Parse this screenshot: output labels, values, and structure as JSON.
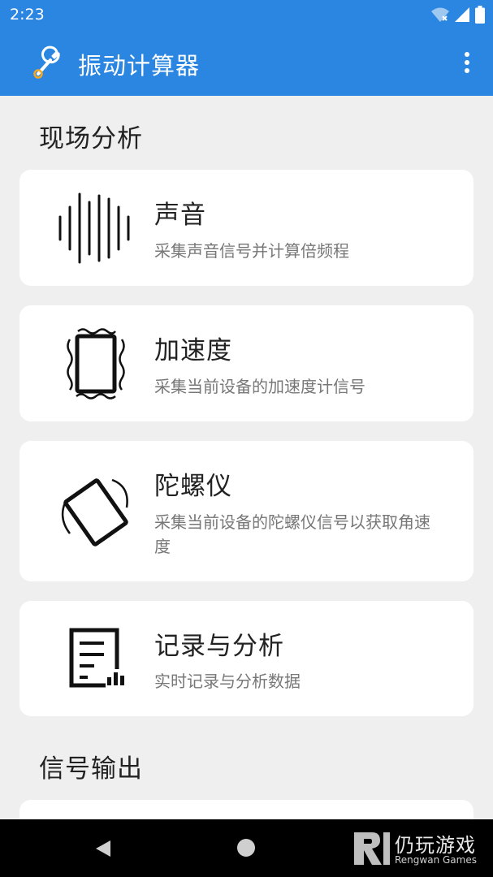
{
  "status_bar": {
    "time": "2:23"
  },
  "app_bar": {
    "title": "振动计算器"
  },
  "sections": [
    {
      "title": "现场分析",
      "cards": [
        {
          "title": "声音",
          "description": "采集声音信号并计算倍频程",
          "icon": "sound-wave-icon"
        },
        {
          "title": "加速度",
          "description": "采集当前设备的加速度计信号",
          "icon": "vibrating-phone-icon"
        },
        {
          "title": "陀螺仪",
          "description": "采集当前设备的陀螺仪信号以获取角速度",
          "icon": "rotating-phone-icon"
        },
        {
          "title": "记录与分析",
          "description": "实时记录与分析数据",
          "icon": "document-chart-icon"
        }
      ]
    },
    {
      "title": "信号输出",
      "cards": []
    }
  ],
  "watermark": {
    "cn": "仍玩游戏",
    "en": "Rengwan Games"
  },
  "colors": {
    "primary": "#2a86e1",
    "background": "#efefef",
    "card": "#ffffff",
    "nav": "#000000"
  }
}
